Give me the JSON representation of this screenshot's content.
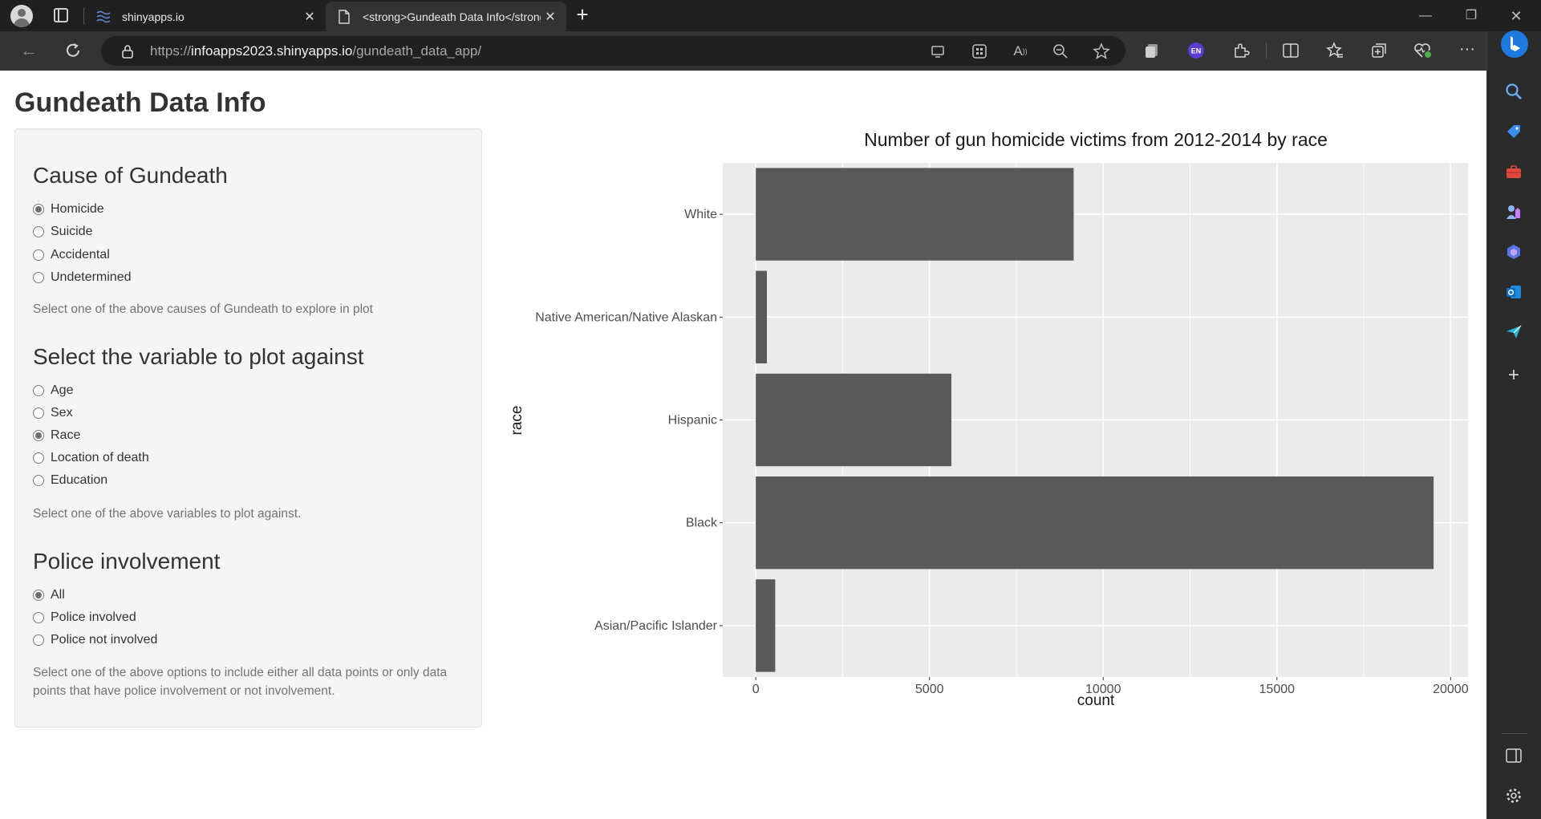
{
  "browser": {
    "tabs": [
      {
        "title": "shinyapps.io",
        "active": false
      },
      {
        "title": "<strong>Gundeath Data Info</strong>",
        "active": true
      }
    ],
    "address": {
      "prefix": "https://",
      "host": "infoapps2023.shinyapps.io",
      "path": "/gundeath_data_app/"
    },
    "toolbar_icons": [
      "back-icon",
      "refresh-icon",
      "lock-icon",
      "app-available-icon",
      "extensions-grid-icon",
      "read-aloud-icon",
      "zoom-out-icon",
      "favorite-star-icon",
      "collections-icon",
      "language-extension-icon",
      "extensions-icon",
      "split-screen-icon",
      "favorites-icon",
      "tab-collections-icon",
      "browser-essentials-icon",
      "more-icon",
      "copilot-icon"
    ],
    "sidebar_icons": [
      "search-icon",
      "shopping-tag-icon",
      "tools-briefcase-icon",
      "games-icon",
      "microsoft-365-icon",
      "outlook-icon",
      "send-icon",
      "add-icon",
      "sidebar-toggle-icon",
      "settings-icon"
    ],
    "profile_badge": "EN",
    "colors": {
      "tabstrip": "#202020",
      "toolbar": "#333333",
      "accent_blue": "#1f7ae0",
      "badge_purple": "#5b3bd1",
      "green": "#4caf50"
    }
  },
  "app": {
    "title": "Gundeath Data Info",
    "cause": {
      "heading": "Cause of Gundeath",
      "options": [
        "Homicide",
        "Suicide",
        "Accidental",
        "Undetermined"
      ],
      "selected": "Homicide",
      "help": "Select one of the above causes of Gundeath to explore in plot"
    },
    "variable": {
      "heading": "Select the variable to plot against",
      "options": [
        "Age",
        "Sex",
        "Race",
        "Location of death",
        "Education"
      ],
      "selected": "Race",
      "help": "Select one of the above variables to plot against."
    },
    "police": {
      "heading": "Police involvement",
      "options": [
        "All",
        "Police involved",
        "Police not involved"
      ],
      "selected": "All",
      "help": "Select one of the above options to include either all data points or only data points that have police involvement or not involvement."
    }
  },
  "chart_data": {
    "type": "bar",
    "orientation": "horizontal",
    "title": "Number of gun homicide victims from 2012-2014 by race",
    "xlabel": "count",
    "ylabel": "race",
    "categories": [
      "White",
      "Native American/Native Alaskan",
      "Hispanic",
      "Black",
      "Asian/Pacific Islander"
    ],
    "values": [
      9150,
      320,
      5630,
      19510,
      560
    ],
    "xlim": [
      -950,
      20500
    ],
    "xticks": [
      "0",
      "5000",
      "10000",
      "15000",
      "20000"
    ],
    "grid": true,
    "colors": {
      "panel": "#ebebeb",
      "bar": "#595959",
      "grid": "#ffffff"
    }
  }
}
